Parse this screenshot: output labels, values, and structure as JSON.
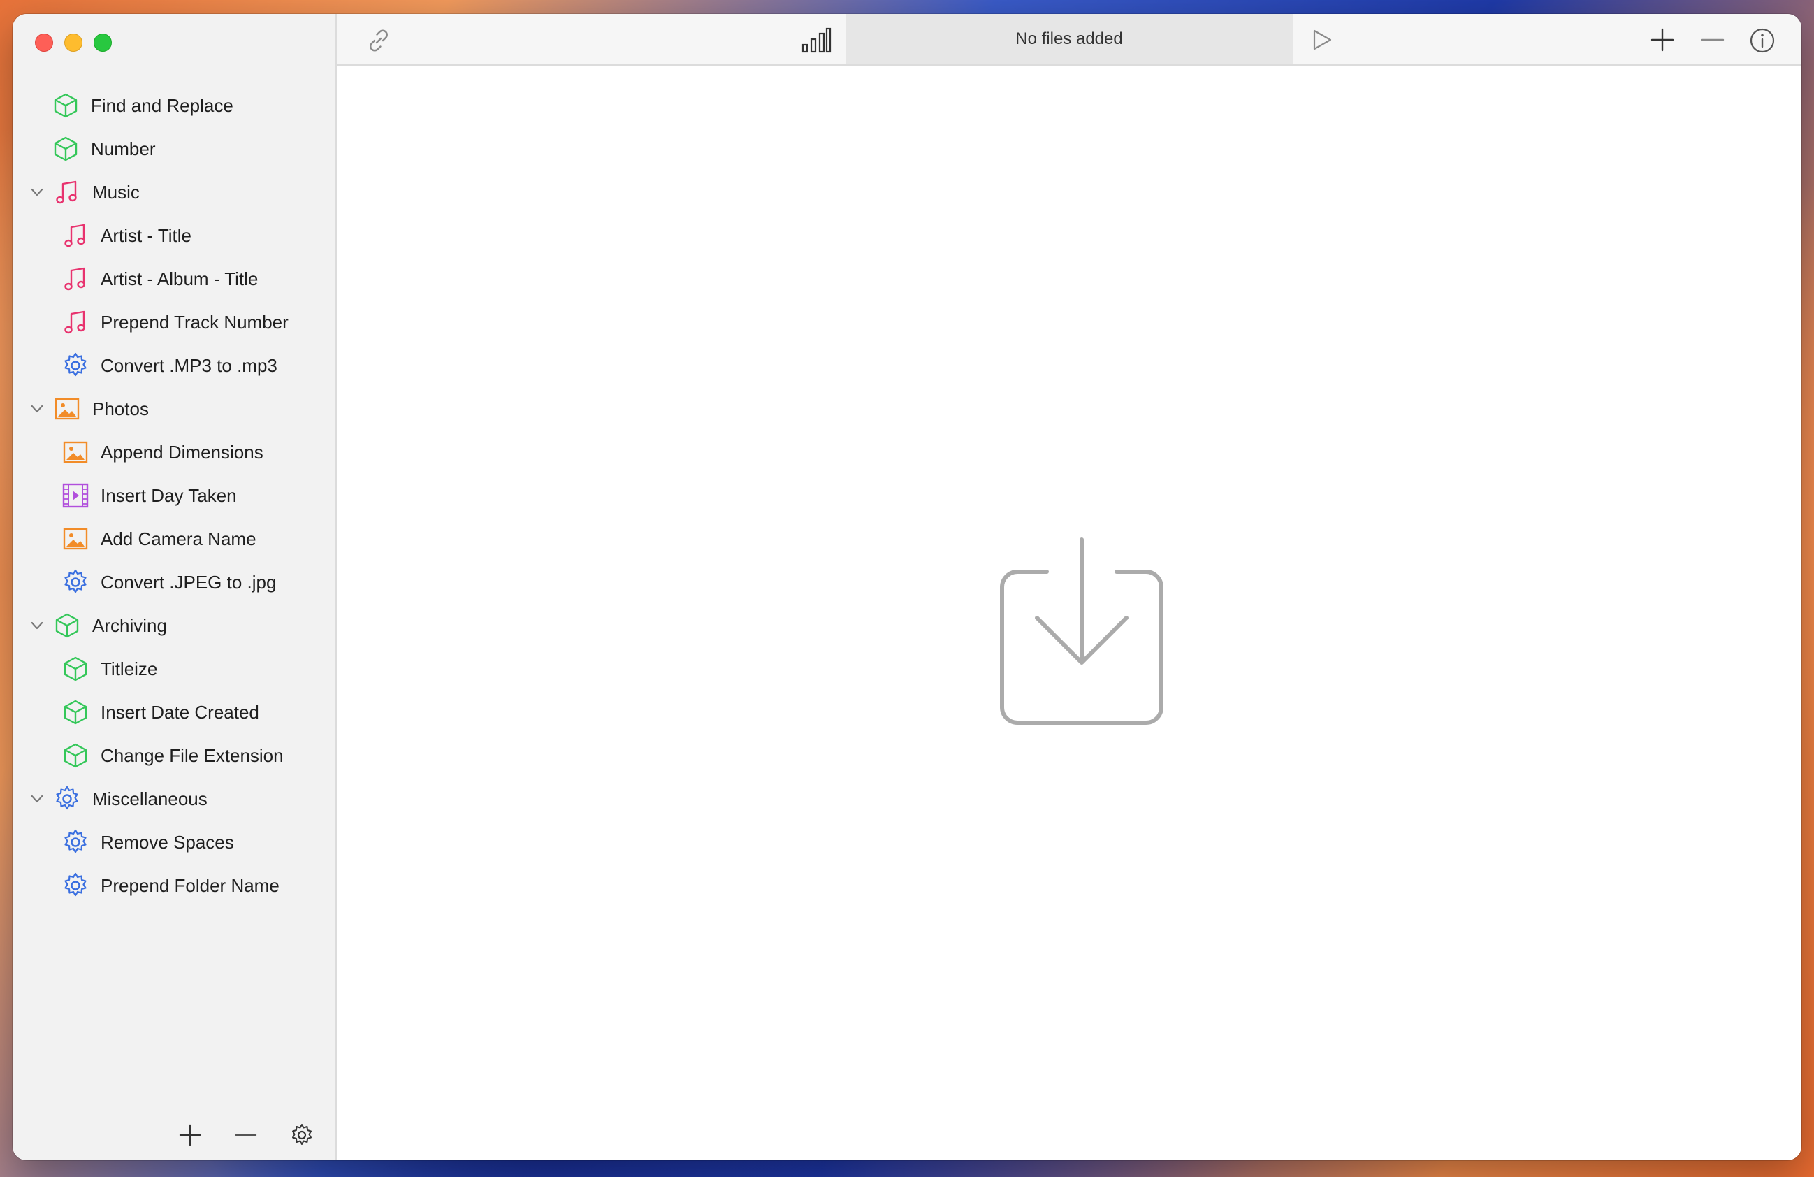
{
  "window": {
    "status_text": "No files added"
  },
  "sidebar": {
    "items": [
      {
        "label": "Find and Replace",
        "icon": "cube-icon",
        "level": 0
      },
      {
        "label": "Number",
        "icon": "cube-icon",
        "level": 0
      },
      {
        "label": "Music",
        "icon": "music-note-icon",
        "level": 0,
        "group": true,
        "expanded": true
      },
      {
        "label": "Artist - Title",
        "icon": "music-note-icon",
        "level": 1
      },
      {
        "label": "Artist - Album - Title",
        "icon": "music-note-icon",
        "level": 1
      },
      {
        "label": "Prepend Track Number",
        "icon": "music-note-icon",
        "level": 1
      },
      {
        "label": "Convert .MP3 to .mp3",
        "icon": "gear-icon",
        "level": 1
      },
      {
        "label": "Photos",
        "icon": "photo-icon",
        "level": 0,
        "group": true,
        "expanded": true
      },
      {
        "label": "Append Dimensions",
        "icon": "photo-icon",
        "level": 1
      },
      {
        "label": "Insert Day Taken",
        "icon": "film-icon",
        "level": 1
      },
      {
        "label": "Add Camera Name",
        "icon": "photo-icon",
        "level": 1
      },
      {
        "label": "Convert .JPEG to .jpg",
        "icon": "gear-icon",
        "level": 1
      },
      {
        "label": "Archiving",
        "icon": "cube-icon",
        "level": 0,
        "group": true,
        "expanded": true
      },
      {
        "label": "Titleize",
        "icon": "cube-icon",
        "level": 1
      },
      {
        "label": "Insert Date Created",
        "icon": "cube-icon",
        "level": 1
      },
      {
        "label": "Change File Extension",
        "icon": "cube-icon",
        "level": 1
      },
      {
        "label": "Miscellaneous",
        "icon": "gear-icon",
        "level": 0,
        "group": true,
        "expanded": true
      },
      {
        "label": "Remove Spaces",
        "icon": "gear-icon",
        "level": 1
      },
      {
        "label": "Prepend Folder Name",
        "icon": "gear-icon",
        "level": 1
      }
    ],
    "footer": [
      "add-icon",
      "remove-icon",
      "gear-icon"
    ]
  },
  "toolbar": {
    "icons": [
      "link-icon",
      "bar-chart-icon",
      "play-icon",
      "add-icon",
      "remove-icon",
      "info-icon"
    ]
  },
  "main": {
    "icon": "download-tray-icon"
  },
  "colors": {
    "cube": "#34c759",
    "music": "#e8326e",
    "photo": "#f28c28",
    "film": "#b14fdc",
    "gear": "#3a6fe0",
    "close": "#fe5f57",
    "minimize": "#febc2e",
    "maximize": "#28c840"
  }
}
